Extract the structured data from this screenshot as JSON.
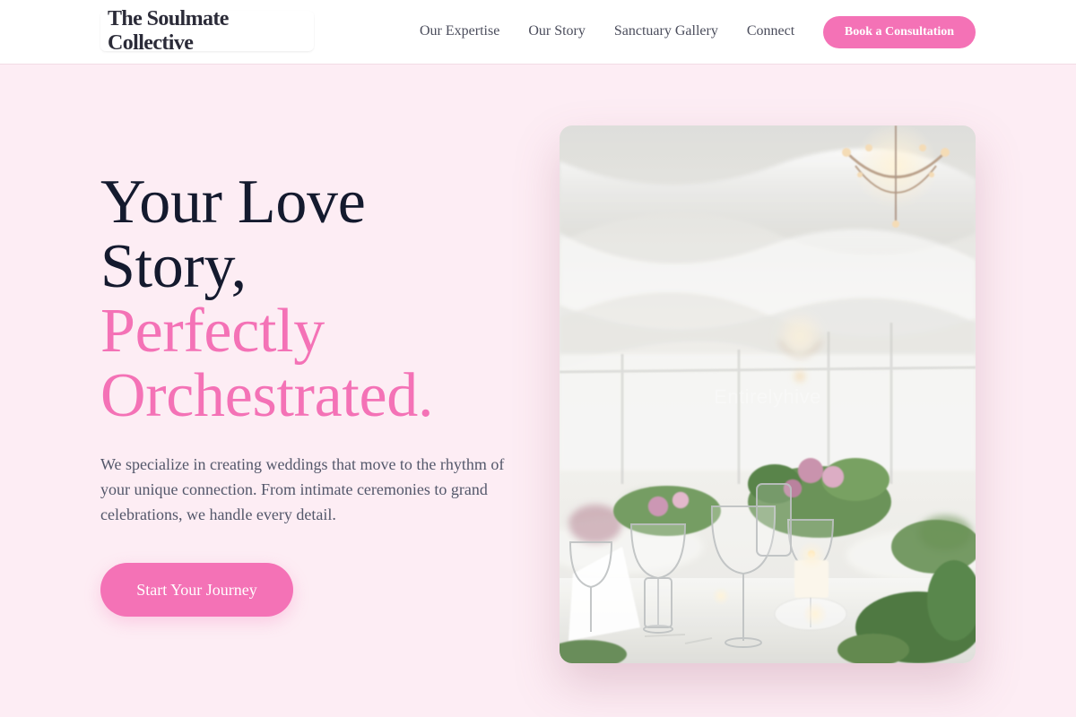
{
  "brand": {
    "name": "The Soulmate Collective"
  },
  "nav": {
    "links": [
      "Our Expertise",
      "Our Story",
      "Sanctuary Gallery",
      "Connect"
    ],
    "cta_label": "Book a Consultation"
  },
  "hero": {
    "title_dark_line1": "Your Love",
    "title_dark_line2": "Story,",
    "title_pink_line1": "Perfectly",
    "title_pink_line2": "Orchestrated.",
    "description": "We specialize in creating weddings that move to the rhythm of your unique connection. From intimate ceremonies to grand celebrations, we handle every detail.",
    "cta_label": "Start Your Journey",
    "image_watermark": "Entirelyhive"
  },
  "colors": {
    "accent": "#f472b6",
    "background": "#fdedf4",
    "heading": "#141a2e",
    "body_text": "#53576a"
  }
}
